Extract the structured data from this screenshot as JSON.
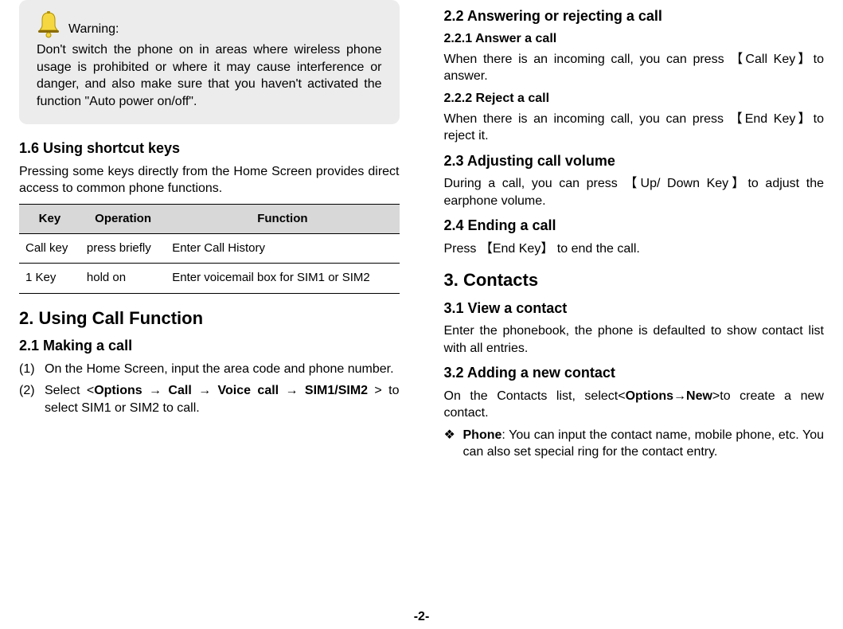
{
  "warning": {
    "title": "Warning:",
    "text": "Don't switch the phone on in areas where wireless phone usage is prohibited or where it may cause interference or danger, and also make sure that you haven't activated the function \"Auto power on/off\"."
  },
  "sec16": {
    "heading": "1.6 Using shortcut keys",
    "intro": "Pressing some keys directly from the Home Screen provides direct access to common phone functions.",
    "table": {
      "headers": [
        "Key",
        "Operation",
        "Function"
      ],
      "rows": [
        [
          "Call key",
          "press briefly",
          "Enter Call History"
        ],
        [
          "1 Key",
          "hold on",
          "Enter voicemail box for SIM1 or SIM2"
        ]
      ]
    }
  },
  "sec2": {
    "heading": "2. Using Call Function",
    "s21": {
      "heading": "2.1 Making a call",
      "items": [
        {
          "num": "(1)",
          "text": "On the Home Screen, input the area code and phone number."
        },
        {
          "num": "(2)",
          "prefix": "Select  <",
          "b1": "Options",
          "a1": " → ",
          "b2": "Call",
          "a2": " → ",
          "b3": "Voice  call",
          "a3": " → ",
          "b4": "SIM1/SIM2",
          "suffix": " > to select SIM1 or SIM2 to call."
        }
      ]
    },
    "s22": {
      "heading": "2.2 Answering or rejecting a call",
      "s221_h": "2.2.1 Answer a call",
      "s221_t": "When there is an incoming call, you can press 【Call Key】to answer.",
      "s222_h": "2.2.2 Reject a call",
      "s222_t": "When there is an incoming call, you can press 【End Key】to reject it."
    },
    "s23": {
      "heading": "2.3 Adjusting call volume",
      "text": "During a call, you can press  【Up/ Down Key】to adjust the earphone volume."
    },
    "s24": {
      "heading": "2.4 Ending a call",
      "text": "Press  【End Key】  to end the call."
    }
  },
  "sec3": {
    "heading": "3. Contacts",
    "s31": {
      "heading": "3.1 View a contact",
      "text": "Enter the phonebook, the phone is defaulted to show contact list with all entries."
    },
    "s32": {
      "heading": "3.2 Adding a new contact",
      "intro_pre": "On the Contacts list, select<",
      "intro_b1": "Options",
      "intro_mid": "→",
      "intro_b2": "New",
      "intro_post": ">to create a new contact.",
      "bullet": {
        "sym": "❖",
        "b": "Phone",
        "rest": ": You can input the contact name, mobile phone, etc. You can also set special ring for the contact entry."
      }
    }
  },
  "pagenum": "-2-"
}
